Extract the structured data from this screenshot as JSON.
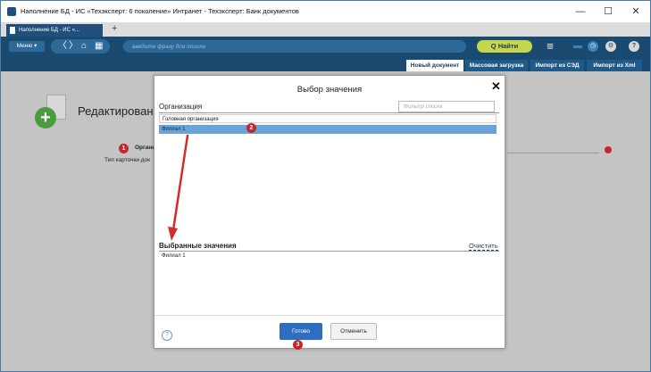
{
  "window": {
    "title": "Наполнение БД - ИС «Техэксперт: 6 поколение» Интранет - Техэксперт: Банк документов",
    "minimize": "—",
    "maximize": "☐",
    "close": "✕"
  },
  "browser_tab": {
    "label": "Наполнение БД - ИС «...",
    "new_tab": "+"
  },
  "navbar": {
    "menu_label": "Меню ▾",
    "back": "〈",
    "forward": "〉",
    "home": "⌂",
    "grid": "▦",
    "search_placeholder": "введите фразу для поиска",
    "find_label": "Q Найти",
    "burger": "≡",
    "folder": "▬",
    "history": "◷",
    "settings": "⚙",
    "help": "?"
  },
  "subtabs": {
    "new_document": "Новый документ",
    "bulk_upload": "Массовая загрузка",
    "import_sed": "Импорт из СЭД",
    "import_xml": "Импорт из Xml"
  },
  "background_form": {
    "title": "Редактировани",
    "org_label": "Организ",
    "type_label": "Тип карточки док"
  },
  "badges": {
    "one": "1",
    "two": "2",
    "three": "3"
  },
  "modal": {
    "title": "Выбор значения",
    "close": "✕",
    "org_header": "Организация",
    "filter_placeholder": "Фильтр списка",
    "options": [
      "Головная организация",
      "Филиал 1"
    ],
    "selected_header": "Выбранные значения",
    "clear_label": "Очистить",
    "selected_items": [
      "Филиал 1"
    ],
    "help": "?",
    "ok_label": "Готово",
    "cancel_label": "Отменить"
  },
  "colors": {
    "brand_blue": "#1b4a70",
    "find_green": "#c6d64a",
    "selection_blue": "#6aa4d6",
    "ok_blue": "#2d6ec0",
    "badge_red": "#c8252a",
    "arrow_red": "#d42a2a"
  }
}
